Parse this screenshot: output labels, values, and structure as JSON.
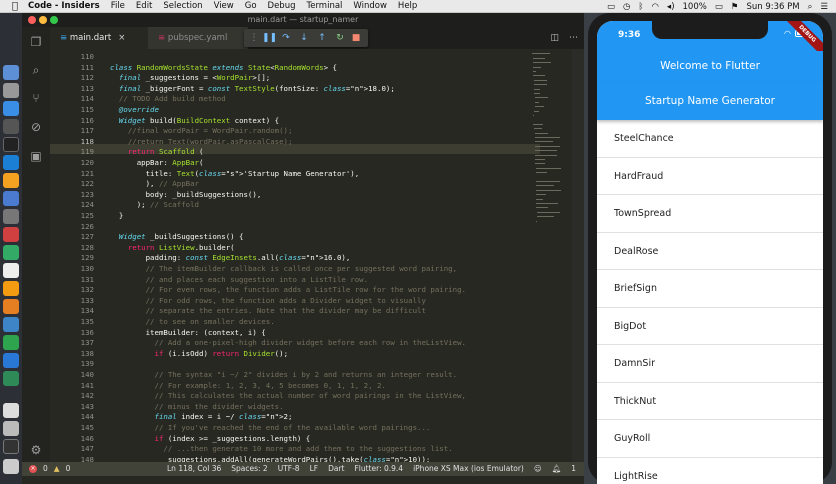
{
  "menubar": {
    "apple_icon": "apple-icon",
    "app_name": "Code - Insiders",
    "items": [
      "File",
      "Edit",
      "Selection",
      "View",
      "Go",
      "Debug",
      "Terminal",
      "Window",
      "Help"
    ],
    "battery": "100%",
    "clock": "Sun 9:36 PM"
  },
  "vscode": {
    "window_title": "main.dart — startup_namer",
    "tabs": [
      {
        "label": "main.dart",
        "active": true
      },
      {
        "label": "pubspec.yaml",
        "active": false
      }
    ],
    "current_line": 118,
    "lines": [
      {
        "n": 110,
        "t": ""
      },
      {
        "n": 111,
        "t": "class RandomWordsState extends State<RandomWords> {"
      },
      {
        "n": 112,
        "t": "  final _suggestions = <WordPair>[];"
      },
      {
        "n": 113,
        "t": "  final _biggerFont = const TextStyle(fontSize: 18.0);"
      },
      {
        "n": 114,
        "t": "  // TODO Add build method"
      },
      {
        "n": 115,
        "t": "  @override"
      },
      {
        "n": 116,
        "t": "  Widget build(BuildContext context) {"
      },
      {
        "n": 117,
        "t": "    //final wordPair = WordPair.random();"
      },
      {
        "n": 118,
        "t": "    //return Text(wordPair.asPascalCase);"
      },
      {
        "n": 119,
        "t": "    return Scaffold ("
      },
      {
        "n": 120,
        "t": "      appBar: AppBar("
      },
      {
        "n": 121,
        "t": "        title: Text('Startup Name Generator'),"
      },
      {
        "n": 122,
        "t": "        ), // AppBar"
      },
      {
        "n": 123,
        "t": "        body: _buildSuggestions(),"
      },
      {
        "n": 124,
        "t": "      ); // Scaffold"
      },
      {
        "n": 125,
        "t": "  }"
      },
      {
        "n": 126,
        "t": ""
      },
      {
        "n": 127,
        "t": "  Widget _buildSuggestions() {"
      },
      {
        "n": 128,
        "t": "    return ListView.builder("
      },
      {
        "n": 129,
        "t": "        padding: const EdgeInsets.all(16.0),"
      },
      {
        "n": 130,
        "t": "        // The itemBuilder callback is called once per suggested word pairing,"
      },
      {
        "n": 131,
        "t": "        // and places each suggestion into a ListTile row."
      },
      {
        "n": 132,
        "t": "        // For even rows, the function adds a ListTile row for the word pairing."
      },
      {
        "n": 133,
        "t": "        // For odd rows, the function adds a Divider widget to visually"
      },
      {
        "n": 134,
        "t": "        // separate the entries. Note that the divider may be difficult"
      },
      {
        "n": 135,
        "t": "        // to see on smaller devices."
      },
      {
        "n": 136,
        "t": "        itemBuilder: (context, i) {"
      },
      {
        "n": 137,
        "t": "          // Add a one-pixel-high divider widget before each row in theListView."
      },
      {
        "n": 138,
        "t": "          if (i.isOdd) return Divider();"
      },
      {
        "n": 139,
        "t": ""
      },
      {
        "n": 140,
        "t": "          // The syntax \"i ~/ 2\" divides i by 2 and returns an integer result."
      },
      {
        "n": 141,
        "t": "          // For example: 1, 2, 3, 4, 5 becomes 0, 1, 1, 2, 2."
      },
      {
        "n": 142,
        "t": "          // This calculates the actual number of word pairings in the ListView,"
      },
      {
        "n": 143,
        "t": "          // minus the divider widgets."
      },
      {
        "n": 144,
        "t": "          final index = i ~/ 2;"
      },
      {
        "n": 145,
        "t": "          // If you've reached the end of the available word pairings..."
      },
      {
        "n": 146,
        "t": "          if (index >= _suggestions.length) {"
      },
      {
        "n": 147,
        "t": "            // ...then generate 10 more and add them to the suggestions list."
      },
      {
        "n": 148,
        "t": "            _suggestions.addAll(generateWordPairs().take(10));"
      },
      {
        "n": 149,
        "t": "          }"
      }
    ],
    "status": {
      "errors": "0",
      "warnings": "0",
      "position": "Ln 118, Col 36",
      "spaces": "Spaces: 2",
      "encoding": "UTF-8",
      "eol": "LF",
      "language": "Dart",
      "flutter": "Flutter: 0.9.4",
      "device": "iPhone XS Max (ios Emulator)",
      "notifications": "1"
    }
  },
  "phone": {
    "time": "9:36",
    "debug_banner": "DEBUG",
    "appbar_title": "Welcome to Flutter",
    "screen_title": "Startup Name Generator",
    "suggestions": [
      "SteelChance",
      "HardFraud",
      "TownSpread",
      "DealRose",
      "BriefSign",
      "BigDot",
      "DamnSir",
      "ThickNut",
      "GuyRoll",
      "LightRise"
    ],
    "accent_color": "#2196f3"
  }
}
